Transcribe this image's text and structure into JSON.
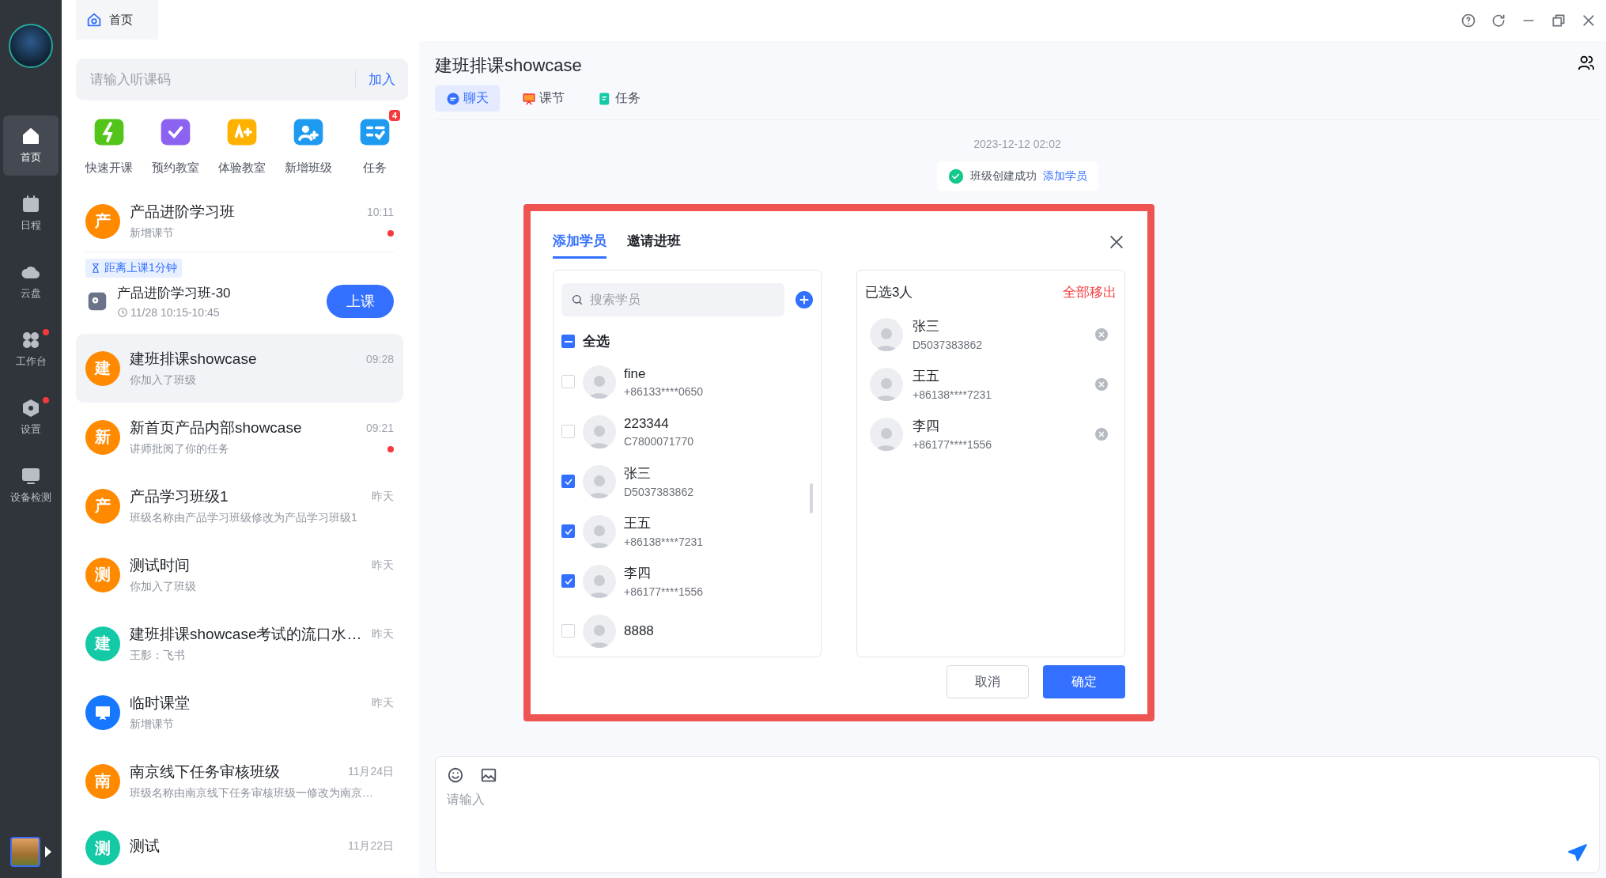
{
  "rail": {
    "items": [
      {
        "label": "首页",
        "kind": "home",
        "selected": true,
        "dot": false
      },
      {
        "label": "日程",
        "kind": "calendar",
        "selected": false,
        "dot": false
      },
      {
        "label": "云盘",
        "kind": "cloud",
        "selected": false,
        "dot": false
      },
      {
        "label": "工作台",
        "kind": "grid",
        "selected": false,
        "dot": true
      },
      {
        "label": "设置",
        "kind": "settings",
        "selected": false,
        "dot": true
      },
      {
        "label": "设备检测",
        "kind": "monitor",
        "selected": false,
        "dot": false
      }
    ]
  },
  "home_tab": {
    "label": "首页"
  },
  "code_input": {
    "placeholder": "请输入听课码",
    "action": "加入"
  },
  "shortcuts": [
    {
      "label": "快速开课",
      "kind": "bolt",
      "color": "#52c41a"
    },
    {
      "label": "预约教室",
      "kind": "check",
      "color": "#8b63f0"
    },
    {
      "label": "体验教室",
      "kind": "ab",
      "color": "#ffb100"
    },
    {
      "label": "新增班级",
      "kind": "people",
      "color": "#1e9bf0"
    },
    {
      "label": "任务",
      "kind": "task",
      "color": "#1e9bf0",
      "badge": "4"
    }
  ],
  "conversations": [
    {
      "avatar": "产",
      "kind": "text",
      "color": "#ff8a00",
      "title": "产品进阶学习班",
      "subtitle": "新增课节",
      "time": "10:11",
      "unread": true,
      "selected": false,
      "lesson": {
        "countdown": "距离上课1分钟",
        "name": "产品进阶学习班-30",
        "time": "11/28 10:15-10:45",
        "button": "上课"
      }
    },
    {
      "avatar": "建",
      "kind": "text",
      "color": "#ff8a00",
      "title": "建班排课showcase",
      "subtitle": "你加入了班级",
      "time": "09:28",
      "unread": false,
      "selected": true
    },
    {
      "avatar": "新",
      "kind": "text",
      "color": "#ff8a00",
      "title": "新首页产品内部showcase",
      "subtitle": "讲师批阅了你的任务",
      "time": "09:21",
      "unread": true,
      "selected": false
    },
    {
      "avatar": "产",
      "kind": "text",
      "color": "#ff8a00",
      "title": "产品学习班级1",
      "subtitle": "班级名称由产品学习班级修改为产品学习班级1",
      "time": "昨天",
      "unread": false,
      "selected": false
    },
    {
      "avatar": "测",
      "kind": "text",
      "color": "#ff8a00",
      "title": "测试时间",
      "subtitle": "你加入了班级",
      "time": "昨天",
      "unread": false,
      "selected": false
    },
    {
      "avatar": "建",
      "kind": "text",
      "color": "#14c9a6",
      "title": "建班排课showcase考试的流口水…",
      "subtitle": "王影：飞书",
      "time": "昨天",
      "unread": false,
      "selected": false
    },
    {
      "kind": "board",
      "color": "#1677ff",
      "title": "临时课堂",
      "subtitle": "新增课节",
      "time": "昨天",
      "unread": false,
      "selected": false
    },
    {
      "avatar": "南",
      "kind": "text",
      "color": "#ff8a00",
      "title": "南京线下任务审核班级",
      "subtitle": "班级名称由南京线下任务审核班级一修改为南京…",
      "time": "11月24日",
      "unread": false,
      "selected": false
    },
    {
      "avatar": "测",
      "kind": "text",
      "color": "#14c9a6",
      "title": "测试",
      "time": "11月22日",
      "unread": false,
      "selected": false
    }
  ],
  "chat": {
    "title": "建班排课showcase",
    "tabs": [
      {
        "label": "聊天",
        "kind": "chat",
        "selected": true
      },
      {
        "label": "课节",
        "kind": "lesson",
        "selected": false
      },
      {
        "label": "任务",
        "kind": "task",
        "selected": false
      }
    ],
    "date": "2023-12-12 02:02",
    "notice": {
      "text": "班级创建成功",
      "link": "添加学员"
    },
    "composer": {
      "placeholder": "请输入"
    }
  },
  "dialog": {
    "tabs": [
      {
        "label": "添加学员",
        "selected": true
      },
      {
        "label": "邀请进班",
        "selected": false
      }
    ],
    "search": {
      "placeholder": "搜索学员"
    },
    "select_all": {
      "label": "全选",
      "indeterminate": true
    },
    "students": [
      {
        "name": "fine",
        "id": "+86133****0650",
        "checked": false
      },
      {
        "name": "223344",
        "id": "C7800071770",
        "checked": false
      },
      {
        "name": "张三",
        "id": "D5037383862",
        "checked": true
      },
      {
        "name": "王五",
        "id": "+86138****7231",
        "checked": true
      },
      {
        "name": "李四",
        "id": "+86177****1556",
        "checked": true
      },
      {
        "name": "8888",
        "checked": false
      }
    ],
    "selected_header": "已选3人",
    "remove_all": "全部移出",
    "selected_students": [
      {
        "name": "张三",
        "id": "D5037383862"
      },
      {
        "name": "王五",
        "id": "+86138****7231"
      },
      {
        "name": "李四",
        "id": "+86177****1556"
      }
    ],
    "buttons": [
      {
        "label": "取消",
        "kind": "secondary"
      },
      {
        "label": "确定",
        "kind": "primary"
      }
    ]
  }
}
